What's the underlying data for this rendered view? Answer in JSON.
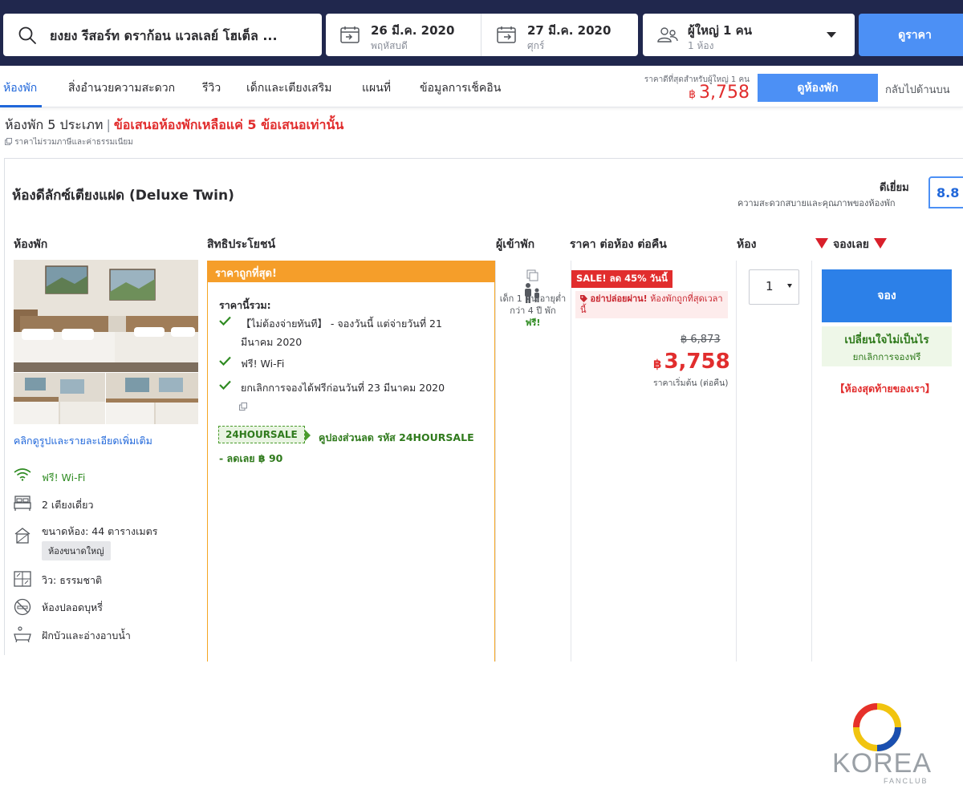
{
  "search": {
    "hotel": "ยงยง รีสอร์ท ดราก้อน แวลเลย์ โฮเต็ล ...",
    "checkin_date": "26 มี.ค. 2020",
    "checkin_day": "พฤหัสบดี",
    "checkout_date": "27 มี.ค. 2020",
    "checkout_day": "ศุกร์",
    "guests": "ผู้ใหญ่ 1 คน",
    "rooms": "1 ห้อง",
    "button": "ดูราคา"
  },
  "nav": {
    "items": [
      "ห้องพัก",
      "สิ่งอำนวยความสะดวก",
      "รีวิว",
      "เด็กและเตียงเสริม",
      "แผนที่",
      "ข้อมูลการเช็คอิน"
    ],
    "price_note": "ราคาดีที่สุดสำหรับผู้ใหญ่ 1 คน",
    "currency": "฿",
    "price": "3,758",
    "view_rooms": "ดูห้องพัก",
    "back_to_top": "กลับไปด้านบน"
  },
  "summary": {
    "room_types": "ห้องพัก 5 ประเภท",
    "separator": "|",
    "alert": "ข้อเสนอห้องพักเหลือแค่ 5 ข้อเสนอเท่านั้น",
    "tax_note": "ราคาไม่รวมภาษีและค่าธรรมเนียม"
  },
  "room": {
    "title": "ห้องดีลักซ์เตียงแฝด (Deluxe Twin)",
    "rating_word": "ดีเยี่ยม",
    "rating_desc": "ความสะดวกสบายและคุณภาพของห้องพัก",
    "score": "8.8",
    "columns": {
      "room": "ห้องพัก",
      "benefits": "สิทธิประโยชน์",
      "occupancy": "ผู้เข้าพัก",
      "price": "ราคา ต่อห้อง ต่อคืน",
      "rooms": "ห้อง",
      "book": "จองเลย"
    },
    "more_link": "คลิกดูรูปและรายละเอียดเพิ่มเติม",
    "features": {
      "wifi": "ฟรี! Wi-Fi",
      "beds": "2 เตียงเดี่ยว",
      "size": "ขนาดห้อง: 44 ตารางเมตร",
      "size_tag": "ห้องขนาดใหญ่",
      "view": "วิว: ธรรมชาติ",
      "nonsmoking": "ห้องปลอดบุหรี่",
      "bath": "ฝักบัวและอ่างอาบน้ำ"
    }
  },
  "offer": {
    "banner": "ราคาถูกที่สุด!",
    "includes": "ราคานี้รวม:",
    "benefits": [
      "【ไม่ต้องจ่ายทันที】 - จองวันนี้ แต่จ่ายวันที่ 21 มีนาคม 2020",
      "ฟรี! Wi-Fi",
      "ยกเลิกการจองได้ฟรีก่อนวันที่ 23 มีนาคม 2020"
    ],
    "coupon_code": "24HOURSALE",
    "coupon_desc": "คูปองส่วนลด รหัส 24HOURSALE",
    "coupon_off": "- ลดเลย ฿ 90",
    "child_note": "เด็ก 1 คน อายุต่ำกว่า 4 ปี พัก",
    "child_free": "ฟรี!",
    "sale_badge": "SALE! ลด 45% วันนี้",
    "dont_miss_bold": "อย่าปล่อยผ่าน!",
    "dont_miss_rest": " ห้องพักถูกที่สุดเวลานี้",
    "old_price": "฿ 6,873",
    "currency": "฿",
    "price": "3,758",
    "per_night": "ราคาเริ่มต้น (ต่อคืน)",
    "qty": "1",
    "book": "จอง",
    "change_mind": "เปลี่ยนใจไม่เป็นไร",
    "free_cancel": "ยกเลิกการจองฟรี",
    "last_room": "【ห้องสุดท้ายของเรา】"
  },
  "watermark": {
    "brand": "KOREA",
    "sub": "FANCLUB"
  },
  "colors": {
    "navy": "#20274d",
    "accent_blue": "#4c90f5",
    "link_blue": "#2067da",
    "price_red": "#e12d2d",
    "orange": "#f59e2a",
    "green": "#2f7a1c"
  }
}
